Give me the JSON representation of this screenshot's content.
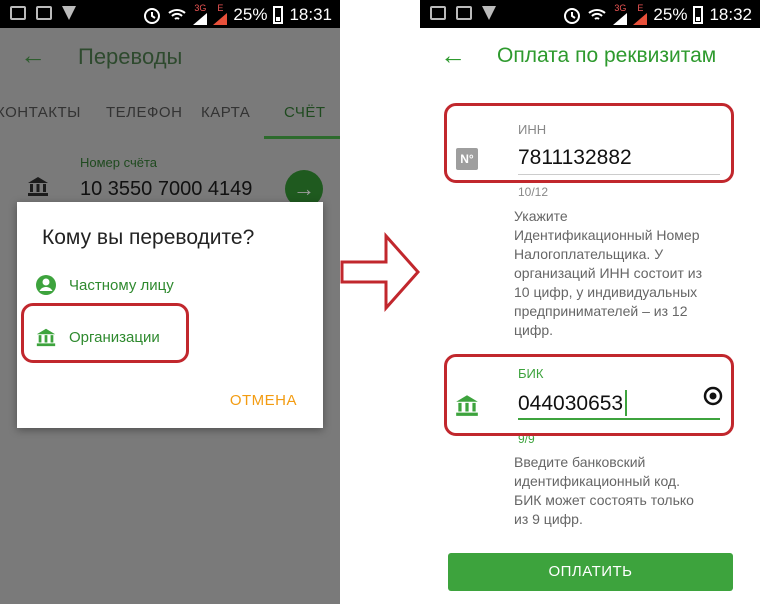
{
  "left_screen": {
    "status_bar": {
      "battery": "25%",
      "time": "18:31",
      "net_3g": "3G",
      "net_e": "E"
    },
    "header": {
      "title": "Переводы"
    },
    "tabs": [
      {
        "label": "КОНТАКТЫ"
      },
      {
        "label": "ТЕЛЕФОН"
      },
      {
        "label": "КАРТА"
      },
      {
        "label": "СЧЁТ"
      }
    ],
    "account": {
      "label": "Номер счёта",
      "value": "10 3550 7000 4149"
    },
    "dialog": {
      "title": "Кому вы переводите?",
      "option_person": "Частному лицу",
      "option_org": "Организации",
      "cancel": "ОТМЕНА"
    }
  },
  "right_screen": {
    "status_bar": {
      "battery": "25%",
      "time": "18:32",
      "net_3g": "3G",
      "net_e": "E"
    },
    "header": {
      "title": "Оплата по реквизитам"
    },
    "inn": {
      "icon_text": "N°",
      "label": "ИНН",
      "value": "7811132882",
      "counter": "10/12",
      "hint_lines": [
        "Укажите",
        "Идентификационный Номер",
        "Налогоплательщика. У",
        "организаций ИНН состоит из",
        "10 цифр, у индивидуальных",
        "предпринимателей – из 12",
        "цифр."
      ]
    },
    "bik": {
      "label": "БИК",
      "value": "044030653",
      "counter": "9/9",
      "hint_lines": [
        "Введите банковский",
        "идентификационный код.",
        "БИК может состоять только",
        "из 9 цифр."
      ]
    },
    "pay_button": "ОПЛАТИТЬ"
  },
  "colors": {
    "green": "#3da33d",
    "dark_green": "#1f5a1f",
    "highlight": "#c1272d",
    "cancel": "#f39c12"
  }
}
